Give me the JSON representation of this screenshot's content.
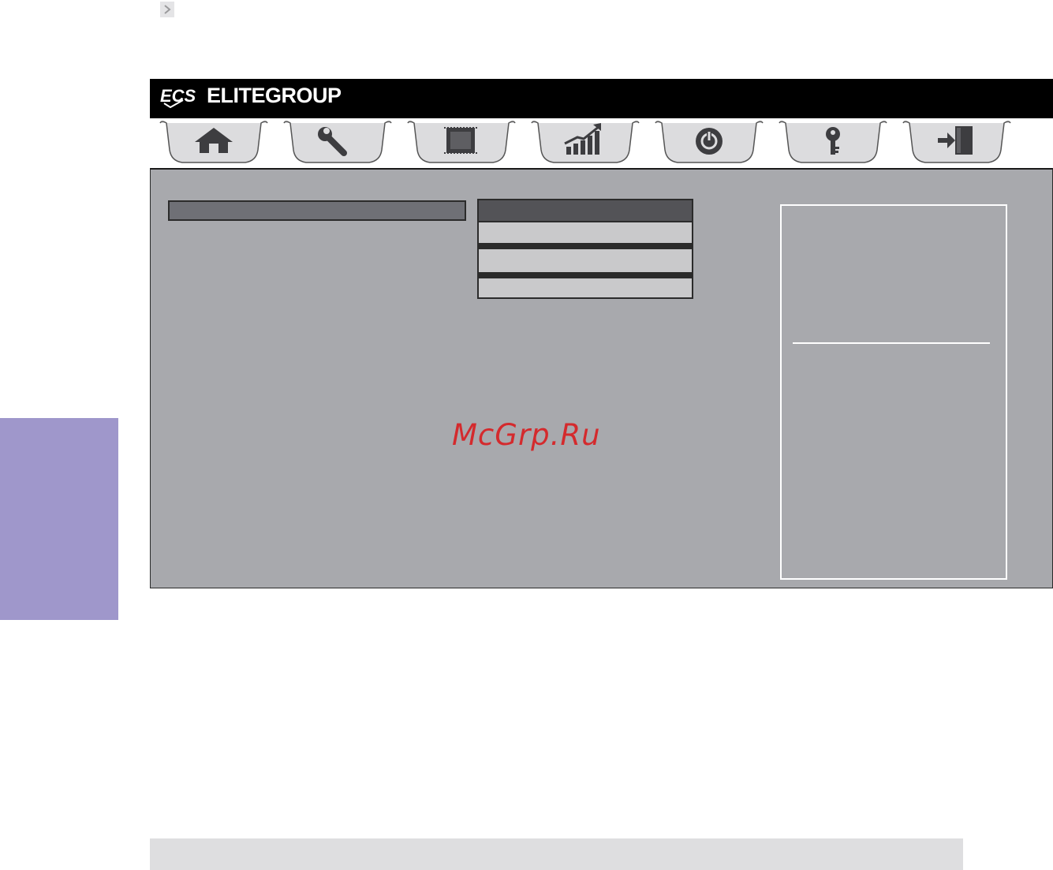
{
  "header": {
    "nav_chevron_icon": "chevron-right-icon"
  },
  "bios": {
    "brand_logo_text": "ECS",
    "brand_name": "ELITEGROUP",
    "tabs": [
      {
        "icon": "home-icon",
        "name": "main"
      },
      {
        "icon": "wrench-icon",
        "name": "advanced"
      },
      {
        "icon": "chip-icon",
        "name": "chipset"
      },
      {
        "icon": "chart-icon",
        "name": "performance"
      },
      {
        "icon": "power-icon",
        "name": "boot"
      },
      {
        "icon": "key-icon",
        "name": "security"
      },
      {
        "icon": "exit-icon",
        "name": "exit"
      }
    ],
    "options": {
      "items_count_label": ""
    }
  },
  "watermark": "McGrp.Ru",
  "colors": {
    "side_tab": "#9f97cb",
    "panel": "#a8a9ad",
    "brand_bar": "#000000",
    "watermark": "#d42a2d"
  }
}
